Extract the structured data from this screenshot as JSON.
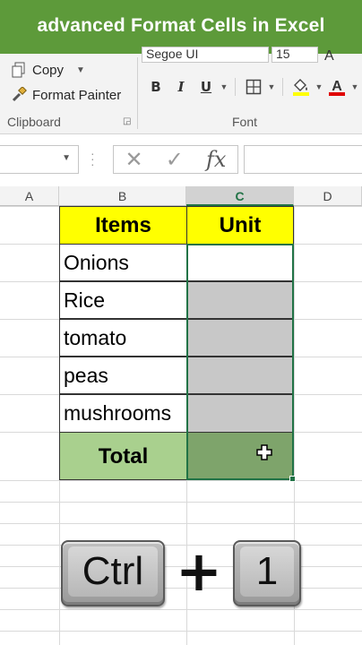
{
  "banner": {
    "title": "advanced Format Cells in Excel"
  },
  "ribbon": {
    "copy_label": "Copy",
    "format_painter_label": "Format Painter",
    "clipboard_group": "Clipboard",
    "font_group": "Font",
    "font_name": "Segoe UI",
    "font_size": "15",
    "bold": "B",
    "italic": "I",
    "underline": "U"
  },
  "formula_bar": {
    "fx_label": "fx",
    "cancel": "✕",
    "enter": "✓",
    "formula": ""
  },
  "columns": [
    "A",
    "B",
    "C",
    "D"
  ],
  "selected_column": "C",
  "table": {
    "header_items": "Items",
    "header_unit": "Unit",
    "rows": [
      "Onions",
      "Rice",
      "tomato",
      "peas",
      "mushrooms"
    ],
    "total_label": "Total"
  },
  "shortcut": {
    "key1": "Ctrl",
    "plus": "+",
    "key2": "1"
  },
  "colors": {
    "banner": "#5d9a3a",
    "header_fill": "#ffff00",
    "unit_fill": "#c8c8c8",
    "total_fill": "#a9d08e",
    "total_unit_fill": "#7ea46b",
    "selection": "#217346"
  }
}
